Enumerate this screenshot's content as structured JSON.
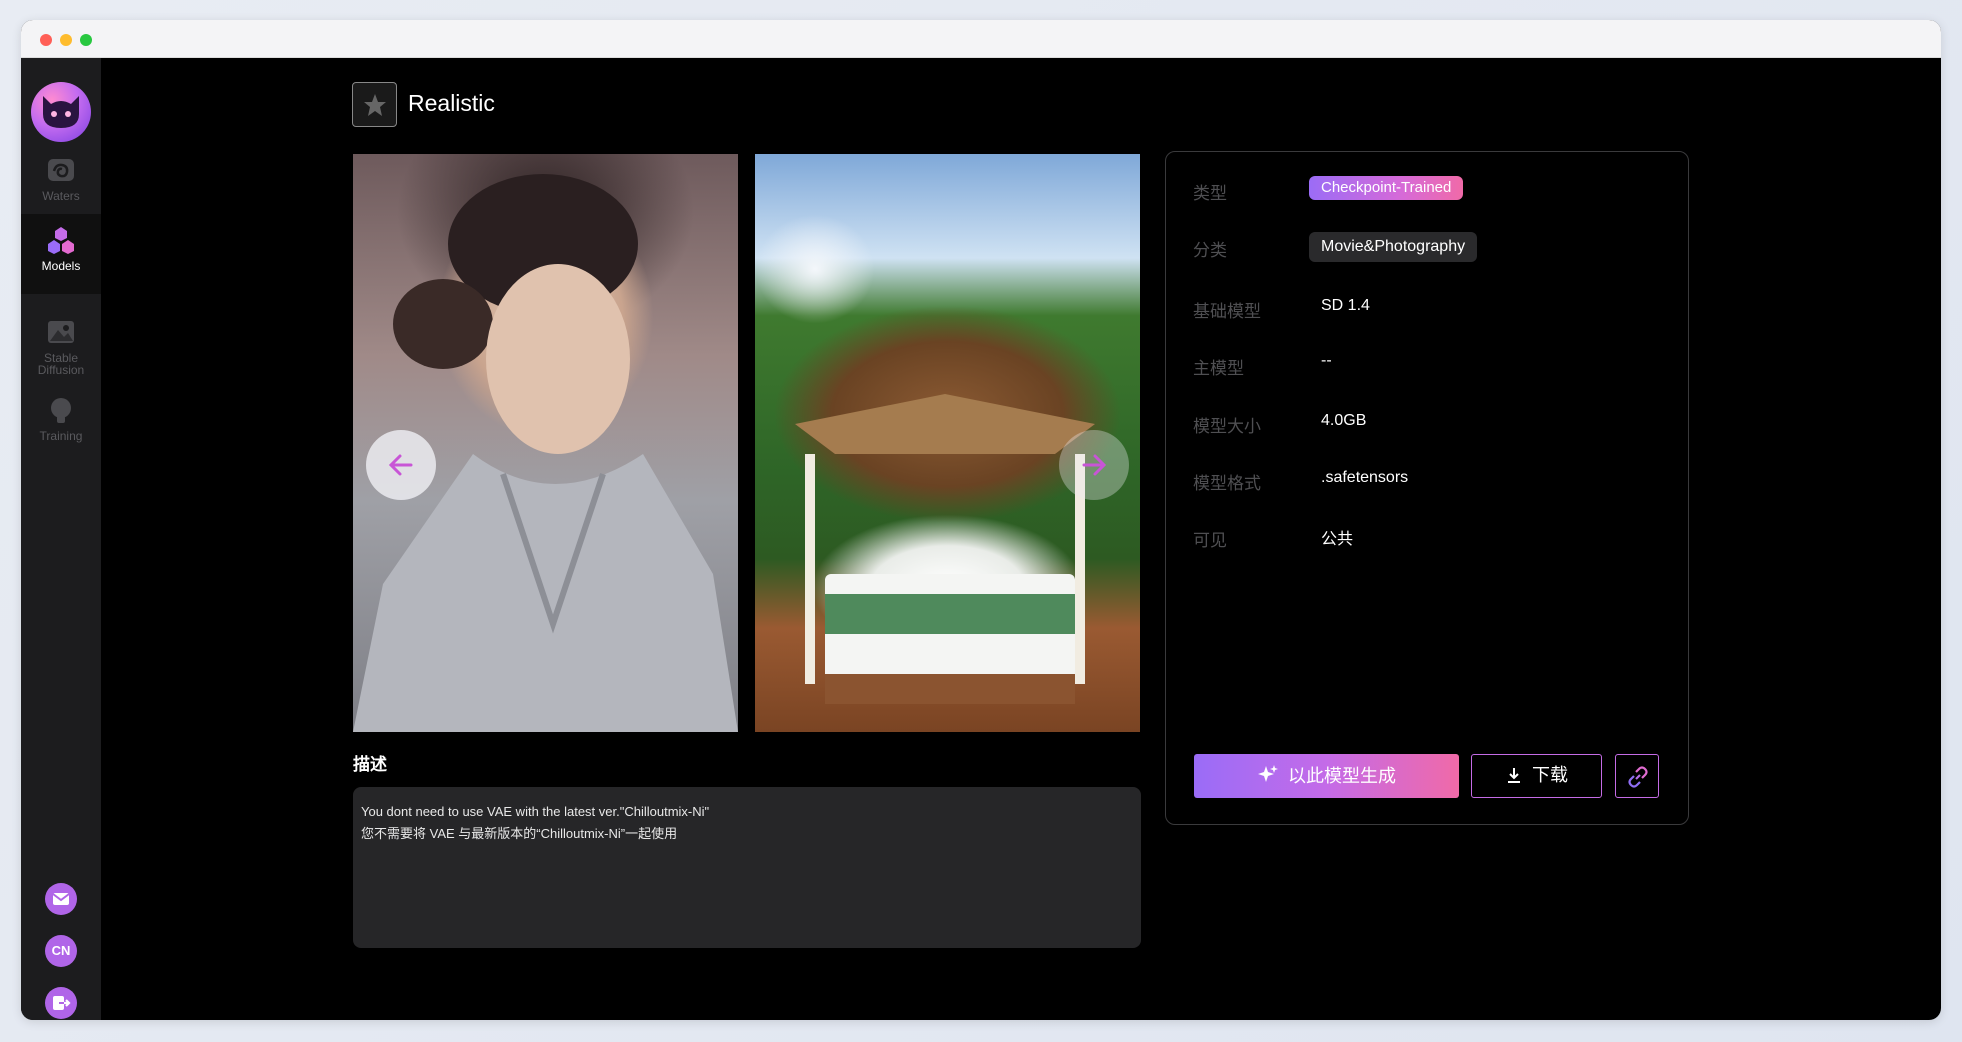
{
  "sidebar": {
    "items": [
      {
        "label": "Waters",
        "icon": "waters-icon"
      },
      {
        "label": "Models",
        "icon": "models-icon"
      },
      {
        "label_line1": "Stable",
        "label_line2": "Diffusion",
        "icon": "image-icon"
      },
      {
        "label": "Training",
        "icon": "lightbulb-icon"
      }
    ],
    "bottom": [
      "mail-icon",
      "language-cn-icon",
      "logout-icon"
    ],
    "lang_label": "CN"
  },
  "header": {
    "title": "Realistic"
  },
  "gallery": {
    "images": [
      {
        "alt": "portrait-photo"
      },
      {
        "alt": "tropical-bed-photo"
      }
    ]
  },
  "description": {
    "heading": "描述",
    "line1": "You dont need to use VAE with the latest ver.\"Chilloutmix-Ni\"",
    "line2": "您不需要将 VAE 与最新版本的“Chilloutmix-Ni”一起使用"
  },
  "info": {
    "rows": [
      {
        "label": "类型",
        "value": "Checkpoint-Trained"
      },
      {
        "label": "分类",
        "value": "Movie&Photography"
      },
      {
        "label": "基础模型",
        "value": "SD 1.4"
      },
      {
        "label": "主模型",
        "value": "--"
      },
      {
        "label": "模型大小",
        "value": "4.0GB"
      },
      {
        "label": "模型格式",
        "value": ".safetensors"
      },
      {
        "label": "可见",
        "value": "公共"
      }
    ],
    "generate_label": "以此模型生成",
    "download_label": "下载"
  },
  "colors": {
    "accent_start": "#9a6cf7",
    "accent_end": "#f06aa8",
    "accent_border": "#c56ce6",
    "background": "#000000",
    "sidebar": "#1c1c1e"
  }
}
